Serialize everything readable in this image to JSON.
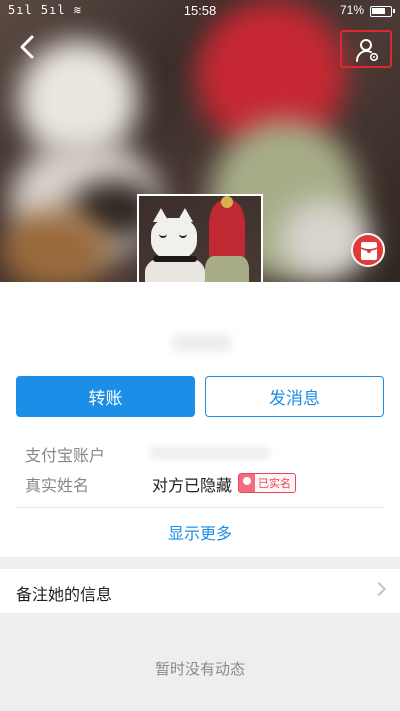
{
  "status_bar": {
    "signal": "5ıl 5ıl ≋",
    "time": "15:58",
    "battery": "71%"
  },
  "header": {
    "back_icon": "back-arrow-icon",
    "settings_icon": "user-settings-icon",
    "redpacket_icon": "red-packet-icon"
  },
  "profile": {
    "verified_icon": "verified-badge-icon"
  },
  "actions": {
    "transfer_label": "转账",
    "message_label": "发消息"
  },
  "info": {
    "account_label": "支付宝账户",
    "realname_label": "真实姓名",
    "realname_value": "对方已隐藏",
    "realname_tag": "已实名",
    "show_more": "显示更多"
  },
  "note": {
    "label": "备注她的信息"
  },
  "feed": {
    "empty_text": "暂时没有动态"
  },
  "colors": {
    "accent": "#1b8ee8",
    "highlight_border": "#e0262f",
    "tag_red": "#e8465a"
  }
}
